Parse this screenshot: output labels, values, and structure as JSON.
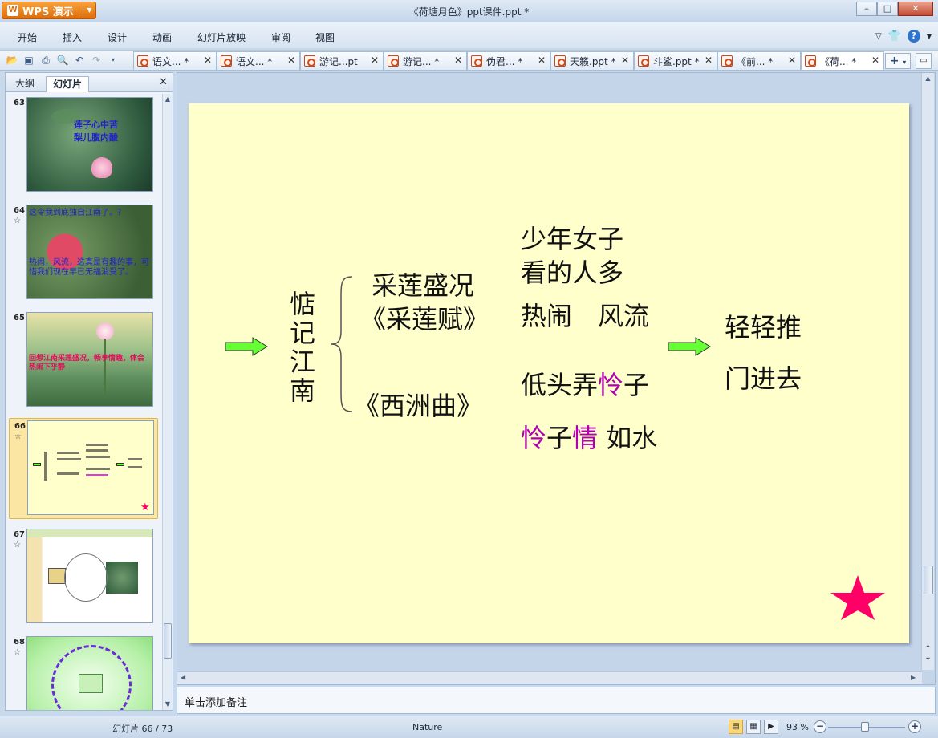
{
  "app": {
    "button_label": "WPS 演示",
    "window_title": "《荷塘月色》ppt课件.ppt *"
  },
  "menu": [
    "开始",
    "插入",
    "设计",
    "动画",
    "幻灯片放映",
    "审阅",
    "视图"
  ],
  "tabs": [
    {
      "label": "语文... *"
    },
    {
      "label": "语文... *"
    },
    {
      "label": "游记...pt"
    },
    {
      "label": "游记... *"
    },
    {
      "label": "伪君... *"
    },
    {
      "label": "天籁.ppt *"
    },
    {
      "label": "斗鲨.ppt *"
    },
    {
      "label": "《前... *"
    },
    {
      "label": "《荷... *"
    }
  ],
  "panel": {
    "tab_outline": "大纲",
    "tab_slides": "幻灯片"
  },
  "thumbnails": [
    {
      "num": "63",
      "text_a": "莲子心中苦",
      "text_b": "梨儿腹内酸"
    },
    {
      "num": "64",
      "text_a": "这令我到底独自江南了。？",
      "text_b": "热闹，风流，这真是有趣的事，可惜我们现在早已无福消受了。"
    },
    {
      "num": "65",
      "text_a": "回想江南采莲盛况，畅享情趣，体会热闹下乎静"
    },
    {
      "num": "66"
    },
    {
      "num": "67"
    },
    {
      "num": "68"
    }
  ],
  "slide": {
    "vertical_title": [
      "惦",
      "记",
      "江",
      "南"
    ],
    "branch_top_1": "采莲盛况",
    "branch_top_2": "《采莲赋》",
    "branch_bottom": "《西洲曲》",
    "col2_line1": "少年女子",
    "col2_line2": "看的人多",
    "col2_line3": "热闹　风流",
    "col2_line4_a": "低头弄",
    "col2_line4_b": "怜",
    "col2_line4_c": "子",
    "col2_line5_a": "怜",
    "col2_line5_b": "子",
    "col2_line5_c": "情",
    "col2_line5_d": " 如水",
    "col3_line1": "轻轻推",
    "col3_line2": "门进去"
  },
  "notes_placeholder": "单击添加备注",
  "status": {
    "slide_counter": "幻灯片 66 / 73",
    "theme": "Nature",
    "zoom": "93 %"
  },
  "colors": {
    "slide_bg": "#ffffcc",
    "accent_purple": "#b300b3",
    "arrow_green": "#66ff33",
    "star_red": "#ff0066"
  }
}
